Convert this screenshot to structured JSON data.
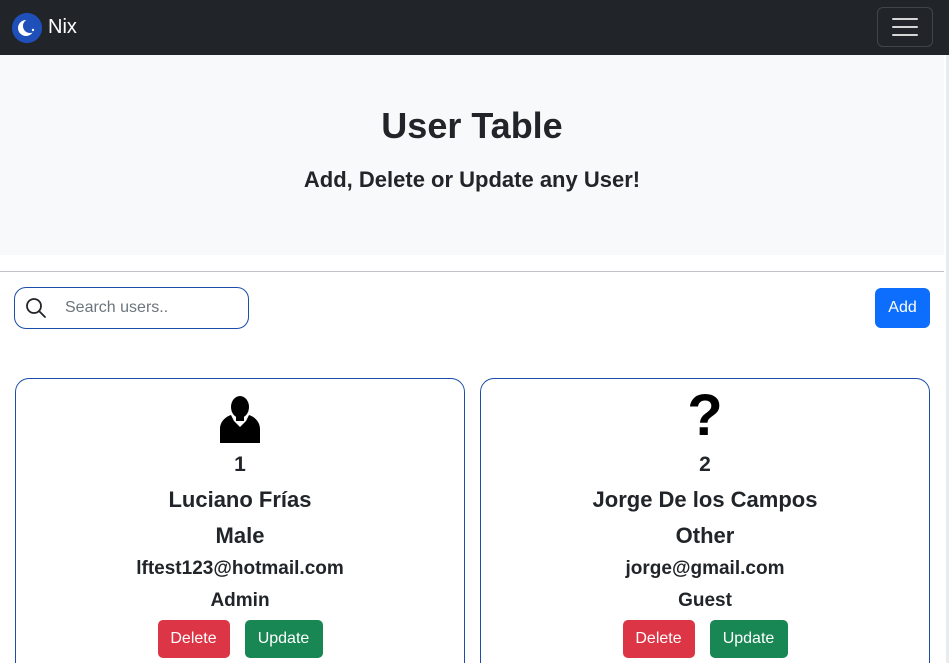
{
  "navbar": {
    "brand": "Nix",
    "logo_icon": "crescent-moon-icon",
    "toggle_icon": "hamburger-menu-icon",
    "background": "#212529"
  },
  "hero": {
    "title": "User Table",
    "subtitle": "Add, Delete or Update any User!"
  },
  "toolbar": {
    "search_placeholder": "Search users..",
    "search_value": "",
    "search_icon": "search-icon",
    "add_label": "Add"
  },
  "users": [
    {
      "avatar": "user-silhouette-icon",
      "id": "1",
      "name": "Luciano Frías",
      "gender": "Male",
      "email": "lftest123@hotmail.com",
      "role": "Admin",
      "delete_label": "Delete",
      "update_label": "Update"
    },
    {
      "avatar": "?",
      "id": "2",
      "name": "Jorge De los Campos",
      "gender": "Other",
      "email": "jorge@gmail.com",
      "role": "Guest",
      "delete_label": "Delete",
      "update_label": "Update"
    }
  ],
  "colors": {
    "primary": "#0d6efd",
    "danger": "#dc3545",
    "success": "#198754",
    "card_border": "#1a4ea8"
  }
}
